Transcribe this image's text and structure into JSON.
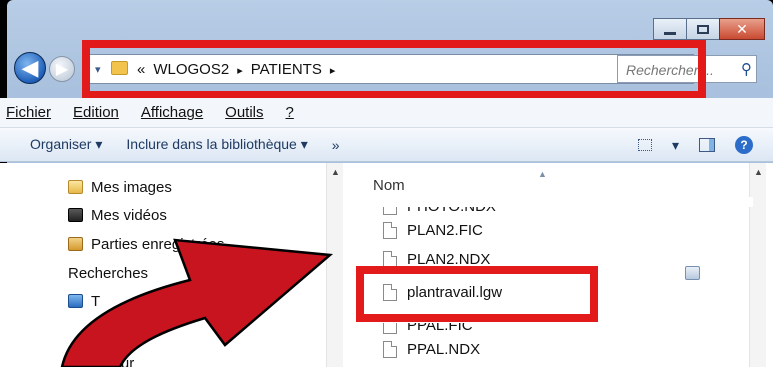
{
  "window": {
    "caption_minimize": "",
    "caption_maximize": "",
    "caption_close": "✕"
  },
  "nav": {
    "back": "◀",
    "forward": "▶"
  },
  "address": {
    "overflow": "«",
    "crumbs": [
      "WLOGOS2",
      "PATIENTS"
    ],
    "separator": "▸",
    "dropdown": "▾",
    "refresh": "↻"
  },
  "search": {
    "placeholder": "Rechercher ..."
  },
  "menu": {
    "items": [
      "Fichier",
      "Edition",
      "Affichage",
      "Outils",
      "?"
    ]
  },
  "toolbar": {
    "organize": "Organiser ▾",
    "include": "Inclure dans la bibliothèque ▾",
    "more": "»",
    "views_dropdown": "▾"
  },
  "tree": {
    "items": [
      "Mes images",
      "Mes vidéos",
      "Parties enregistrées",
      "Recherches",
      "T",
      "ateur"
    ]
  },
  "files": {
    "column": "Nom",
    "items": [
      "PHOTO.NDX",
      "PLAN2.FIC",
      "PLAN2.NDX",
      "plantravail.lgw",
      "PPAL.FIC",
      "PPAL.NDX"
    ]
  },
  "colors": {
    "highlight": "#e21a1a",
    "arrow": "#c8141e"
  }
}
